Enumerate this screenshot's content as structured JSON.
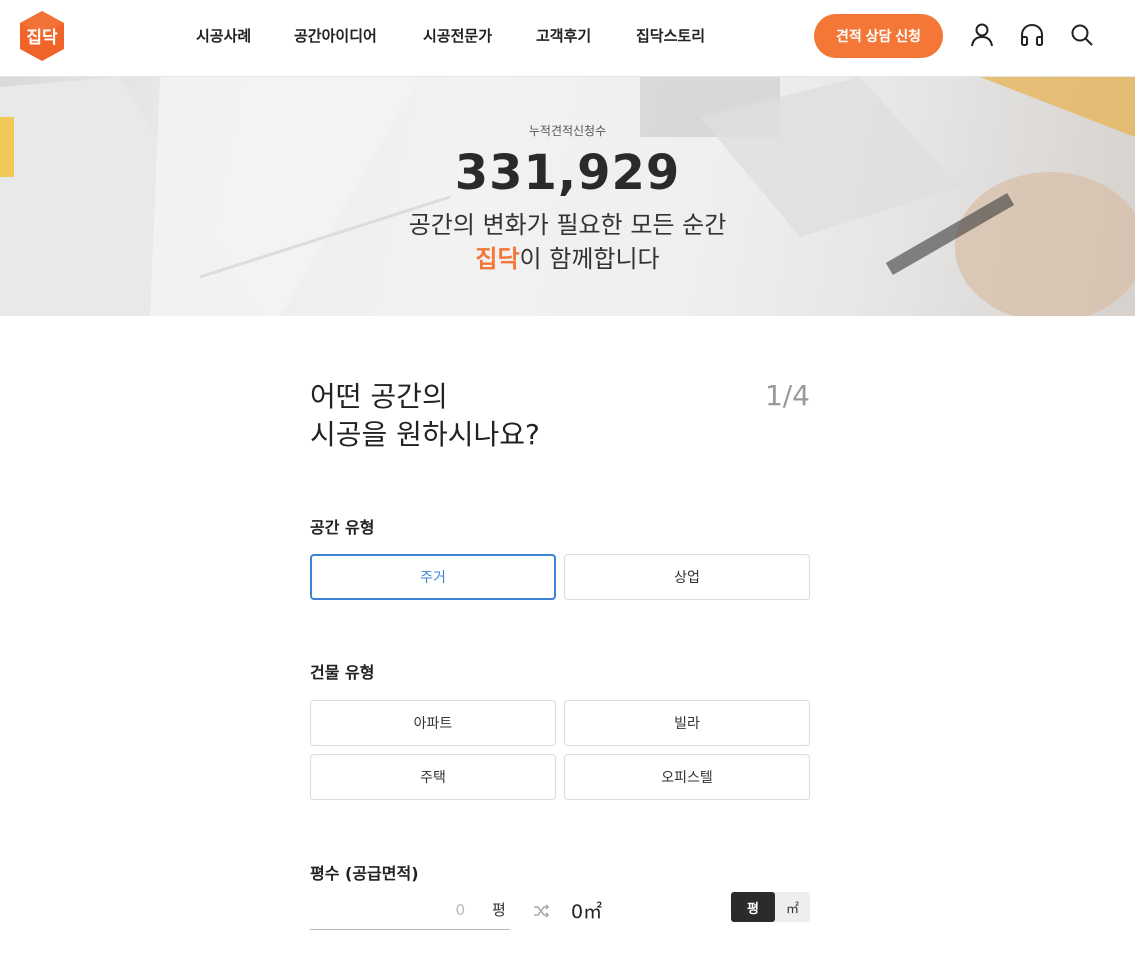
{
  "brand": {
    "logo_text": "집닥",
    "color": "#f47738"
  },
  "nav": {
    "items": [
      {
        "label": "시공사례"
      },
      {
        "label": "공간아이디어"
      },
      {
        "label": "시공전문가"
      },
      {
        "label": "고객후기"
      },
      {
        "label": "집닥스토리"
      }
    ],
    "cta_label": "견적 상담 신청",
    "icons": [
      "user-icon",
      "headset-icon",
      "search-icon"
    ]
  },
  "hero": {
    "label": "누적견적신청수",
    "count": "331,929",
    "line1": "공간의 변화가 필요한 모든 순간",
    "line2_brand": "집닥",
    "line2_rest": "이 함께합니다"
  },
  "form": {
    "question_line1": "어떤 공간의",
    "question_line2": "시공을 원하시나요?",
    "step": "1/4",
    "space_type": {
      "label": "공간 유형",
      "options": [
        "주거",
        "상업"
      ],
      "selected": "주거"
    },
    "building_type": {
      "label": "건물 유형",
      "options": [
        "아파트",
        "빌라",
        "주택",
        "오피스텔"
      ]
    },
    "area": {
      "label": "평수 (공급면적)",
      "placeholder": "0",
      "unit": "평",
      "converted": "0㎡",
      "toggle_active": "평",
      "toggle_inactive": "㎡"
    }
  },
  "colors": {
    "accent": "#f47738",
    "selected_border": "#3c83d8",
    "dark_toggle": "#2b2b2b"
  }
}
